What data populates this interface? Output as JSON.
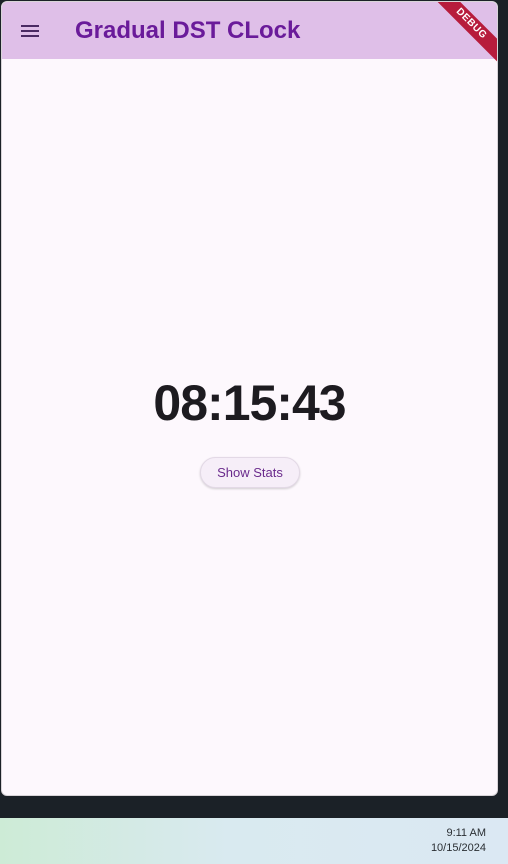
{
  "app": {
    "title": "Gradual DST CLock",
    "debug_label": "DEBUG",
    "menu_icon": "hamburger-menu-icon",
    "colors": {
      "app_bar": "#dfbfe8",
      "title": "#6a1b9a",
      "background": "#fdf8fd",
      "debug_ribbon": "#b71c3c"
    }
  },
  "main": {
    "clock_time": "08:15:43",
    "show_stats_label": "Show Stats"
  },
  "taskbar": {
    "time": "9:11 AM",
    "date": "10/15/2024"
  }
}
